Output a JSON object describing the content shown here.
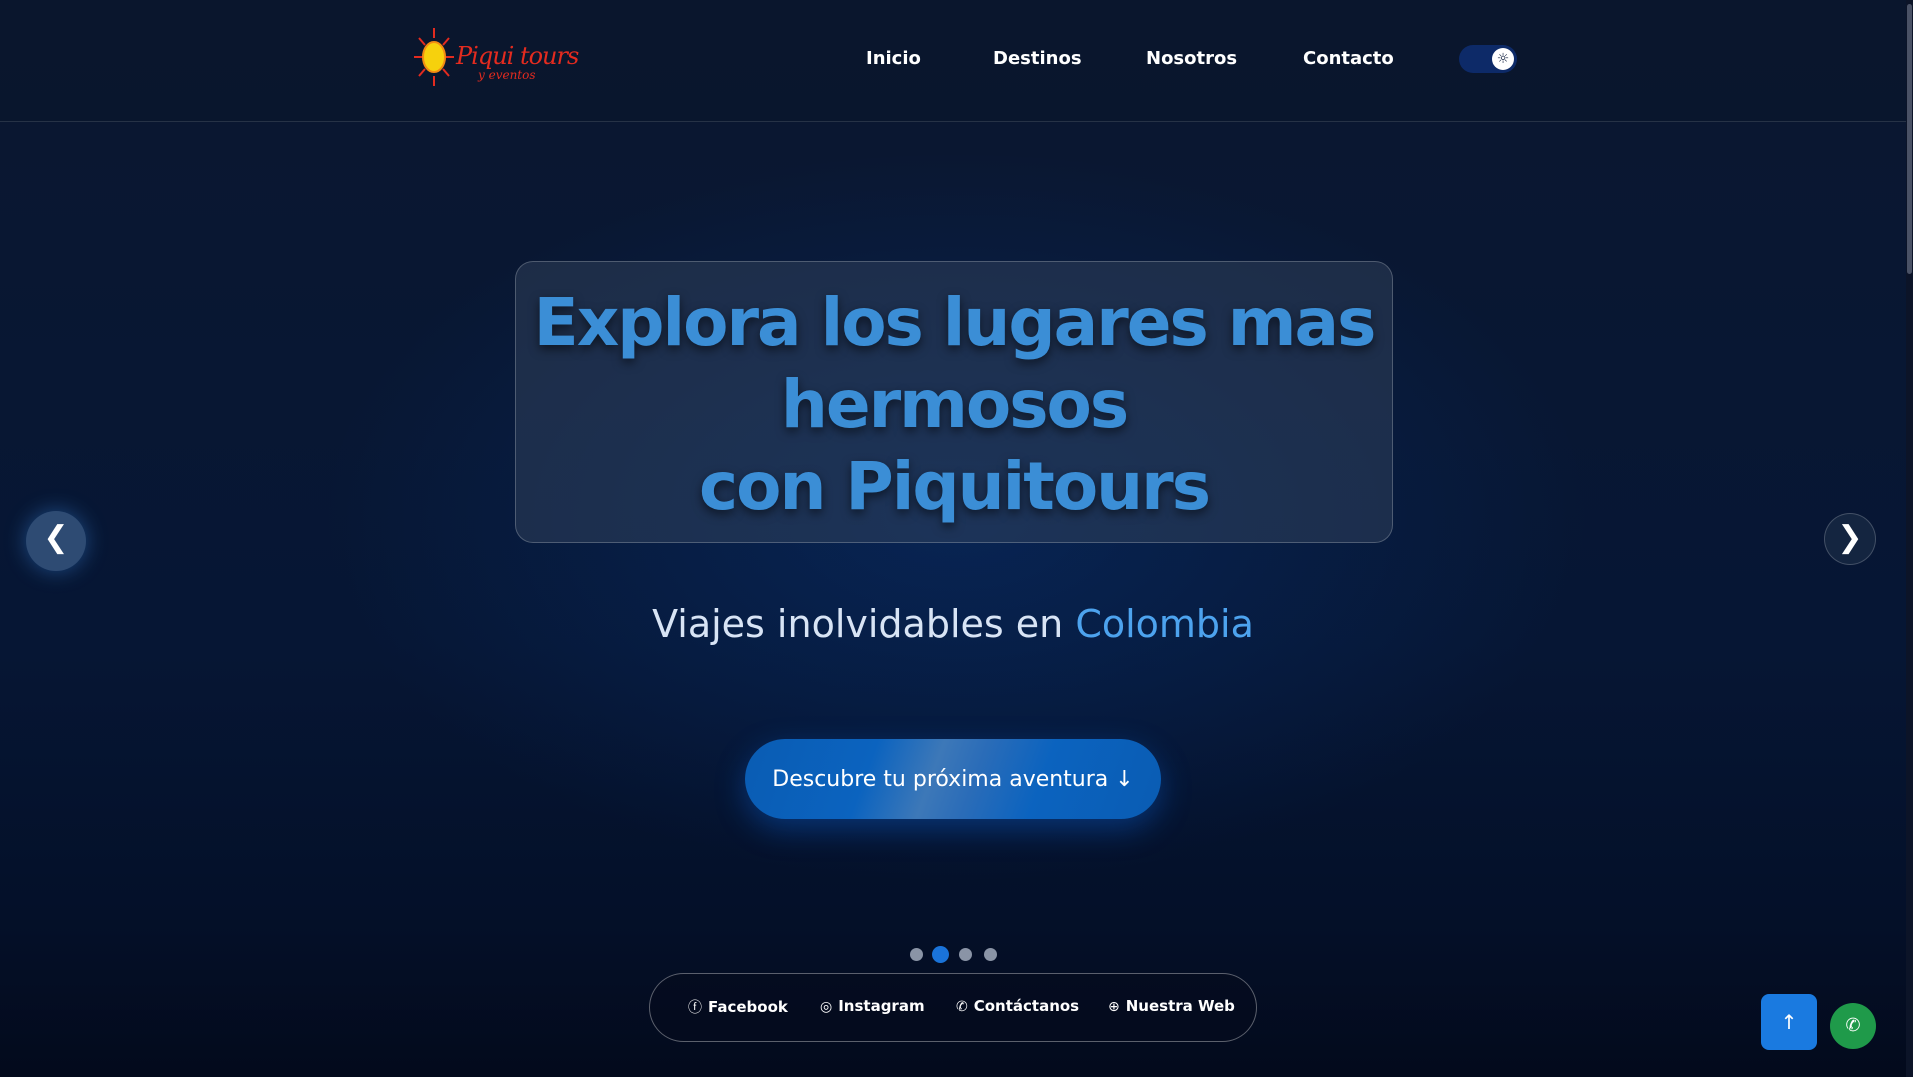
{
  "header": {
    "logo": {
      "brand": "Piqui tours",
      "tagline": "y eventos"
    },
    "nav": [
      {
        "label": "Inicio"
      },
      {
        "label": "Destinos"
      },
      {
        "label": "Nosotros"
      },
      {
        "label": "Contacto"
      }
    ],
    "theme_toggle": {
      "icon": "sun-icon",
      "glyph": "☼"
    }
  },
  "hero": {
    "title_lines": [
      "Explora los lugares mas",
      "hermosos",
      "con Piquitours"
    ],
    "subtitle_main": "Viajes inolvidables en ",
    "subtitle_accent": "Colombia",
    "cta_label": "Descubre tu próxima aventura  ↓",
    "prev_glyph": "❮",
    "next_glyph": "❯"
  },
  "carousel": {
    "total": 4,
    "active_index": 1
  },
  "social": [
    {
      "label": "Facebook",
      "icon": "facebook-icon",
      "glyph": "ⓕ"
    },
    {
      "label": "Instagram",
      "icon": "instagram-icon",
      "glyph": "◎"
    },
    {
      "label": "Contáctanos",
      "icon": "whatsapp-icon",
      "glyph": "✆"
    },
    {
      "label": "Nuestra Web",
      "icon": "globe-icon",
      "glyph": "⊕"
    }
  ],
  "floating": {
    "scroll_top_glyph": "↑",
    "whatsapp_glyph": "✆"
  },
  "colors": {
    "accent": "#3b8ed6",
    "brand_red": "#e32b1f",
    "whatsapp": "#1f9a4a"
  }
}
